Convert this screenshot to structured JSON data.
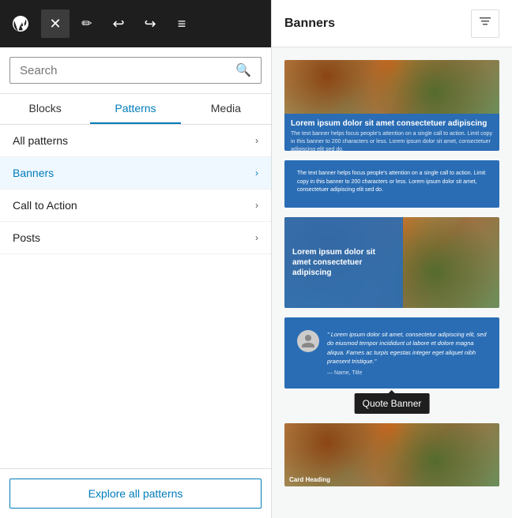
{
  "toolbar": {
    "close_label": "✕",
    "pencil_label": "✏",
    "undo_label": "↩",
    "redo_label": "↪",
    "list_label": "≡"
  },
  "search": {
    "placeholder": "Search",
    "value": ""
  },
  "tabs": [
    {
      "label": "Blocks",
      "active": false
    },
    {
      "label": "Patterns",
      "active": true
    },
    {
      "label": "Media",
      "active": false
    }
  ],
  "patterns": {
    "title": "Patterns",
    "items": [
      {
        "label": "All patterns",
        "active": false
      },
      {
        "label": "Banners",
        "active": true
      },
      {
        "label": "Call to Action",
        "active": false
      },
      {
        "label": "Posts",
        "active": false
      }
    ],
    "explore_label": "Explore all patterns"
  },
  "right_panel": {
    "title": "Banners",
    "filter_icon": "≡",
    "previews": [
      {
        "type": "image_banner",
        "title": "Lorem ipsum dolor sit amet consectetuer adipiscing",
        "desc": "The text banner helps focus people's attention on a single call to action. Limit copy in this banner to 200 characters or less. Lorem ipsum dolor sit amet, consectetuer adipiscing elit sed do."
      },
      {
        "type": "text_banner",
        "desc": "The text banner helps focus people's attention on a single call to action. Limit copy in this banner to 200 characters or less. Lorem ipsum dolor sit amet, consectetuer adipiscing elit sed do."
      },
      {
        "type": "image_overlay_banner",
        "title": "Lorem ipsum dolor sit amet consectetuer adipiscing"
      },
      {
        "type": "quote_banner",
        "quote": "\" Lorem ipsum dolor sit amet, consectetur adipiscing elit, sed do eiusmod tempor incididunt ut labore et dolore magna aliqua. Fames ac turpis egestas integer eget aliquet nibh praesent tristique.\"",
        "author": "— Name, Title",
        "tooltip": "Quote Banner"
      },
      {
        "type": "card_banner",
        "label": "Card Heading"
      }
    ]
  }
}
